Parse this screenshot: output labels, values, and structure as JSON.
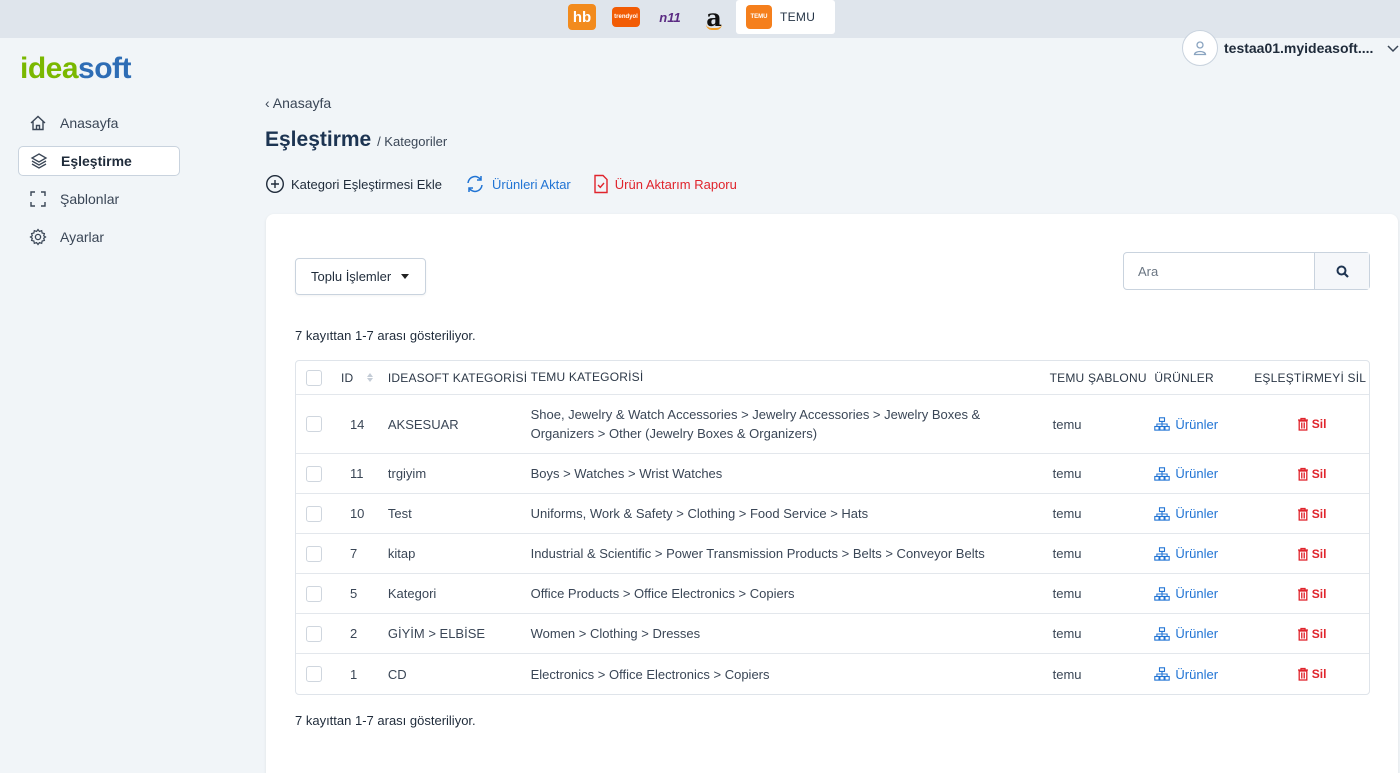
{
  "marketplaces": {
    "hb": "hb",
    "trendyol": "trendyol",
    "n11": "n11",
    "amazon": "a",
    "temu_logo": "TEMU",
    "temu_label": "TEMU"
  },
  "brand": {
    "idea": "idea",
    "soft": "soft"
  },
  "user": {
    "name": "testaa01.myideasoft...."
  },
  "sidebar": {
    "items": [
      {
        "label": "Anasayfa",
        "icon": "home-icon"
      },
      {
        "label": "Eşleştirme",
        "icon": "layers-icon"
      },
      {
        "label": "Şablonlar",
        "icon": "frame-icon"
      },
      {
        "label": "Ayarlar",
        "icon": "gear-icon"
      }
    ]
  },
  "breadcrumb": {
    "back": "Anasayfa"
  },
  "title": {
    "main": "Eşleştirme",
    "sub": "/ Kategoriler"
  },
  "actions": {
    "add": "Kategori Eşleştirmesi Ekle",
    "transfer": "Ürünleri Aktar",
    "report": "Ürün Aktarım Raporu"
  },
  "toolbar": {
    "bulk": "Toplu İşlemler",
    "search_placeholder": "Ara"
  },
  "info": {
    "top": "7 kayıttan 1-7 arası gösteriliyor.",
    "bottom": "7 kayıttan 1-7 arası gösteriliyor."
  },
  "table": {
    "headers": {
      "id": "ID",
      "ideasoft": "IDEASOFT KATEGORİSİ",
      "temu": "TEMU KATEGORİSİ",
      "template": "TEMU ŞABLONU",
      "products": "ÜRÜNLER",
      "delete": "EŞLEŞTİRMEYİ SİL"
    },
    "rows": [
      {
        "id": "14",
        "ideasoft": "AKSESUAR",
        "temu": "Shoe, Jewelry & Watch Accessories > Jewelry Accessories > Jewelry Boxes & Organizers > Other (Jewelry Boxes & Organizers)",
        "template": "temu",
        "products": "Ürünler",
        "delete": "Sil"
      },
      {
        "id": "11",
        "ideasoft": "trgiyim",
        "temu": "Boys > Watches > Wrist Watches",
        "template": "temu",
        "products": "Ürünler",
        "delete": "Sil"
      },
      {
        "id": "10",
        "ideasoft": "Test",
        "temu": "Uniforms, Work & Safety > Clothing > Food Service > Hats",
        "template": "temu",
        "products": "Ürünler",
        "delete": "Sil"
      },
      {
        "id": "7",
        "ideasoft": "kitap",
        "temu": "Industrial & Scientific > Power Transmission Products > Belts > Conveyor Belts",
        "template": "temu",
        "products": "Ürünler",
        "delete": "Sil"
      },
      {
        "id": "5",
        "ideasoft": "Kategori",
        "temu": "Office Products > Office Electronics > Copiers",
        "template": "temu",
        "products": "Ürünler",
        "delete": "Sil"
      },
      {
        "id": "2",
        "ideasoft": "GİYİM > ELBİSE",
        "temu": "Women > Clothing > Dresses",
        "template": "temu",
        "products": "Ürünler",
        "delete": "Sil"
      },
      {
        "id": "1",
        "ideasoft": "CD",
        "temu": "Electronics > Office Electronics > Copiers",
        "template": "temu",
        "products": "Ürünler",
        "delete": "Sil"
      }
    ]
  },
  "colors": {
    "link_blue": "#2174d4",
    "danger_red": "#e0242c",
    "brand_green": "#7ab800",
    "brand_blue": "#2e6db5"
  }
}
